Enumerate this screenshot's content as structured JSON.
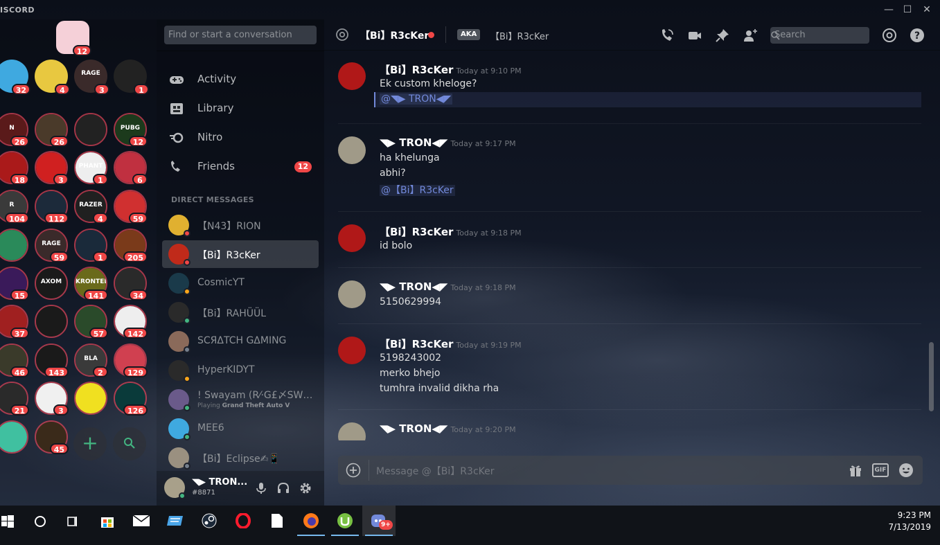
{
  "app": {
    "brand": "ISCORD",
    "min": "—",
    "max": "☐",
    "close": "✕"
  },
  "guild_rail": {
    "home_badge": "12",
    "guilds": [
      {
        "badge": "32",
        "color": "#3fa9e0",
        "title": ""
      },
      {
        "badge": "4",
        "color": "#e8c840",
        "title": ""
      },
      {
        "badge": "3",
        "color": "#3a2a2a",
        "title": "RAGE"
      },
      {
        "badge": "1",
        "color": "#222",
        "title": ""
      },
      {
        "badge": "26",
        "color": "#5a1a1a",
        "title": "N"
      },
      {
        "badge": "26",
        "color": "#4a3a2a",
        "title": ""
      },
      {
        "badge": "",
        "color": "#222",
        "title": ""
      },
      {
        "badge": "12",
        "color": "#1c3a1c",
        "title": "PUBG"
      },
      {
        "badge": "18",
        "color": "#aa1a1a",
        "title": ""
      },
      {
        "badge": "3",
        "color": "#d02020",
        "title": ""
      },
      {
        "badge": "1",
        "color": "#eee",
        "title": "PHANT"
      },
      {
        "badge": "6",
        "color": "#c03040",
        "title": ""
      },
      {
        "badge": "104",
        "color": "#3a3a3a",
        "title": "R"
      },
      {
        "badge": "112",
        "color": "#1c2a3a",
        "title": ""
      },
      {
        "badge": "4",
        "color": "#202020",
        "title": "RAZER"
      },
      {
        "badge": "59",
        "color": "#d03030",
        "title": ""
      },
      {
        "badge": "",
        "color": "#2a8a5a",
        "title": ""
      },
      {
        "badge": "59",
        "color": "#3a2a2a",
        "title": "RAGE"
      },
      {
        "badge": "1",
        "color": "#1a2a3a",
        "title": ""
      },
      {
        "badge": "205",
        "color": "#7a3a1a",
        "title": ""
      },
      {
        "badge": "15",
        "color": "#3a1a5a",
        "title": ""
      },
      {
        "badge": "",
        "color": "#1a1a1a",
        "title": "AXOM"
      },
      {
        "badge": "141",
        "color": "#6a6a1a",
        "title": "KRONTEN"
      },
      {
        "badge": "34",
        "color": "#2a2a2a",
        "title": ""
      },
      {
        "badge": "37",
        "color": "#a02020",
        "title": ""
      },
      {
        "badge": "",
        "color": "#1a1a1a",
        "title": ""
      },
      {
        "badge": "57",
        "color": "#2a4a2a",
        "title": ""
      },
      {
        "badge": "142",
        "color": "#eeeeee",
        "title": ""
      },
      {
        "badge": "46",
        "color": "#3a3a2a",
        "title": ""
      },
      {
        "badge": "143",
        "color": "#1a1a1a",
        "title": ""
      },
      {
        "badge": "2",
        "color": "#3a3a3a",
        "title": "BLA"
      },
      {
        "badge": "129",
        "color": "#d04050",
        "title": ""
      },
      {
        "badge": "21",
        "color": "#2a2a2a",
        "title": ""
      },
      {
        "badge": "3",
        "color": "#f0f0f0",
        "title": ""
      },
      {
        "badge": "",
        "color": "#f0e020",
        "title": ""
      },
      {
        "badge": "126",
        "color": "#0a3a3a",
        "title": ""
      },
      {
        "badge": "",
        "color": "#40c0a0",
        "title": ""
      },
      {
        "badge": "45",
        "color": "#3a2a1a",
        "title": ""
      }
    ]
  },
  "dm_panel": {
    "search_placeholder": "Find or start a conversation",
    "nav": [
      {
        "label": "Activity",
        "icon": "gamepad-icon",
        "badge": ""
      },
      {
        "label": "Library",
        "icon": "library-icon",
        "badge": ""
      },
      {
        "label": "Nitro",
        "icon": "nitro-icon",
        "badge": ""
      },
      {
        "label": "Friends",
        "icon": "friends-icon",
        "badge": "12"
      }
    ],
    "dm_header": "DIRECT MESSAGES",
    "dms": [
      {
        "name": "【N43】RION",
        "status": "#f04747",
        "color": "#e0b030",
        "sub": "",
        "sub_bold": ""
      },
      {
        "name": "【Bi】R3cKer",
        "status": "#f04747",
        "color": "#c02a1a",
        "sub": "",
        "sub_bold": ""
      },
      {
        "name": "CosmicYT",
        "status": "#faa61a",
        "color": "#1a3a4a",
        "sub": "",
        "sub_bold": ""
      },
      {
        "name": "【Bi】RAHÜÜL",
        "status": "#43b581",
        "color": "#2a2a2a",
        "sub": "",
        "sub_bold": ""
      },
      {
        "name": "SCЯΔTCH GΔΜΙΝG",
        "status": "#747f8d",
        "color": "#8a6a5a",
        "sub": "",
        "sub_bold": ""
      },
      {
        "name": "HyperKIDYT",
        "status": "#faa61a",
        "color": "#2a2a2a",
        "sub": "",
        "sub_bold": ""
      },
      {
        "name": "! Swayam (R⁄·G£〆SW…",
        "status": "#43b581",
        "color": "#6a5a8a",
        "sub": "Playing ",
        "sub_bold": "Grand Theft Auto V"
      },
      {
        "name": "MEE6",
        "status": "#43b581",
        "color": "#3fa9e0",
        "sub": "",
        "sub_bold": ""
      },
      {
        "name": "【Bi】Eclipse✍📱",
        "status": "#747f8d",
        "color": "#9a9080",
        "sub": "",
        "sub_bold": ""
      }
    ],
    "user": {
      "name": "◥▶ TRON...",
      "tag": "#8871"
    }
  },
  "chat_header": {
    "name": "【Bi】R3cKer",
    "aka": "AKA",
    "aka_name": "【Bi】R3cKer",
    "search_placeholder": "Search"
  },
  "messages": [
    {
      "author": "【Bi】R3cKer",
      "time": "Today at 9:10 PM",
      "avatar": "#b01818",
      "lines": [
        "Ek custom kheloge?",
        "@◥▶ TRON◀◤"
      ],
      "mention_line": 1
    },
    {
      "author": "◥▶ TRON◀◤",
      "time": "Today at 9:17 PM",
      "avatar": "#a09a88",
      "lines": [
        "ha khelunga",
        "abhi?",
        "@【Bi】R3cKer"
      ],
      "mention_line": 2
    },
    {
      "author": "【Bi】R3cKer",
      "time": "Today at 9:18 PM",
      "avatar": "#b01818",
      "lines": [
        "id bolo"
      ],
      "mention_line": -1
    },
    {
      "author": "◥▶ TRON◀◤",
      "time": "Today at 9:18 PM",
      "avatar": "#a09a88",
      "lines": [
        "5150629994"
      ],
      "mention_line": -1
    },
    {
      "author": "【Bi】R3cKer",
      "time": "Today at 9:19 PM",
      "avatar": "#b01818",
      "lines": [
        "5198243002",
        "merko bhejo",
        "tumhra invalid dikha rha"
      ],
      "mention_line": -1
    },
    {
      "author": "◥▶ TRON◀◤",
      "time": "Today at 9:20 PM",
      "avatar": "#a09a88",
      "lines": [],
      "mention_line": -1
    }
  ],
  "composer": {
    "placeholder": "Message @【Bi】R3cKer",
    "gif": "GIF"
  },
  "taskbar": {
    "time": "9:23 PM",
    "date": "7/13/2019",
    "discord_badge": "9+"
  }
}
